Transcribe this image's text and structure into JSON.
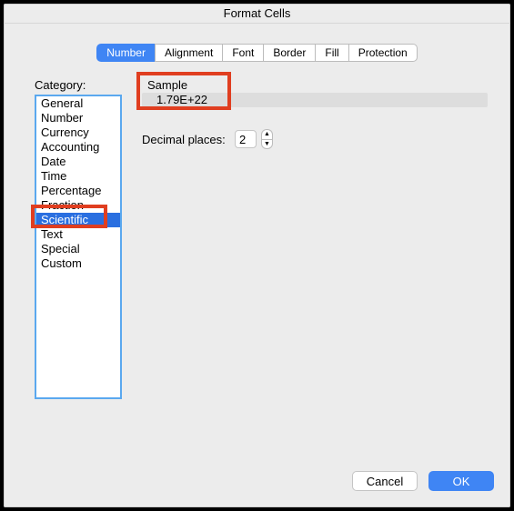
{
  "window": {
    "title": "Format Cells"
  },
  "tabs": {
    "number": "Number",
    "alignment": "Alignment",
    "font": "Font",
    "border": "Border",
    "fill": "Fill",
    "protection": "Protection",
    "active": "number"
  },
  "category": {
    "label": "Category:",
    "items": {
      "general": "General",
      "number": "Number",
      "currency": "Currency",
      "accounting": "Accounting",
      "date": "Date",
      "time": "Time",
      "percentage": "Percentage",
      "fraction": "Fraction",
      "scientific": "Scientific",
      "text": "Text",
      "special": "Special",
      "custom": "Custom"
    },
    "selected": "scientific"
  },
  "sample": {
    "label": "Sample",
    "value": "1.79E+22"
  },
  "decimal": {
    "label": "Decimal places:",
    "value": "2"
  },
  "buttons": {
    "cancel": "Cancel",
    "ok": "OK"
  },
  "highlights": [
    "sample-box",
    "scientific-item"
  ]
}
